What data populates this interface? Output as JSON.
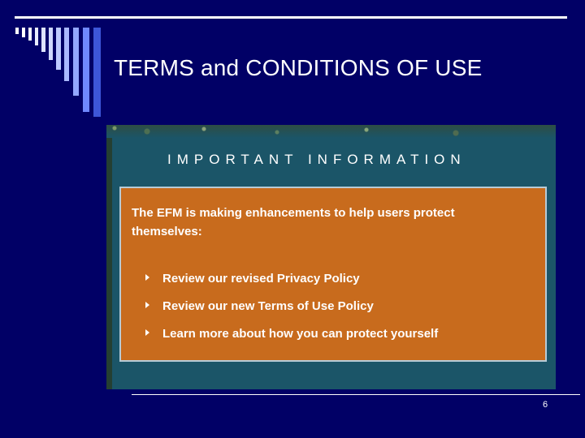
{
  "slide": {
    "title": "TERMS and CONDITIONS OF USE",
    "page_number": "6",
    "background_color": "#010066",
    "line_color": "#ffffff"
  },
  "notice": {
    "heading": "IMPORTANT INFORMATION",
    "intro": "The EFM is making enhancements to help users protect themselves:",
    "items": [
      {
        "label": "Review our revised Privacy Policy",
        "icon": "triangle-bullet-icon"
      },
      {
        "label": "Review our new Terms of Use Policy",
        "icon": "triangle-bullet-icon"
      },
      {
        "label": "Learn more about how you can protect yourself",
        "icon": "triangle-bullet-icon"
      }
    ],
    "colors": {
      "panel": "#1b5568",
      "box": "#c86b1d",
      "box_border": "#b7cbd6",
      "text": "#ffffff"
    }
  }
}
